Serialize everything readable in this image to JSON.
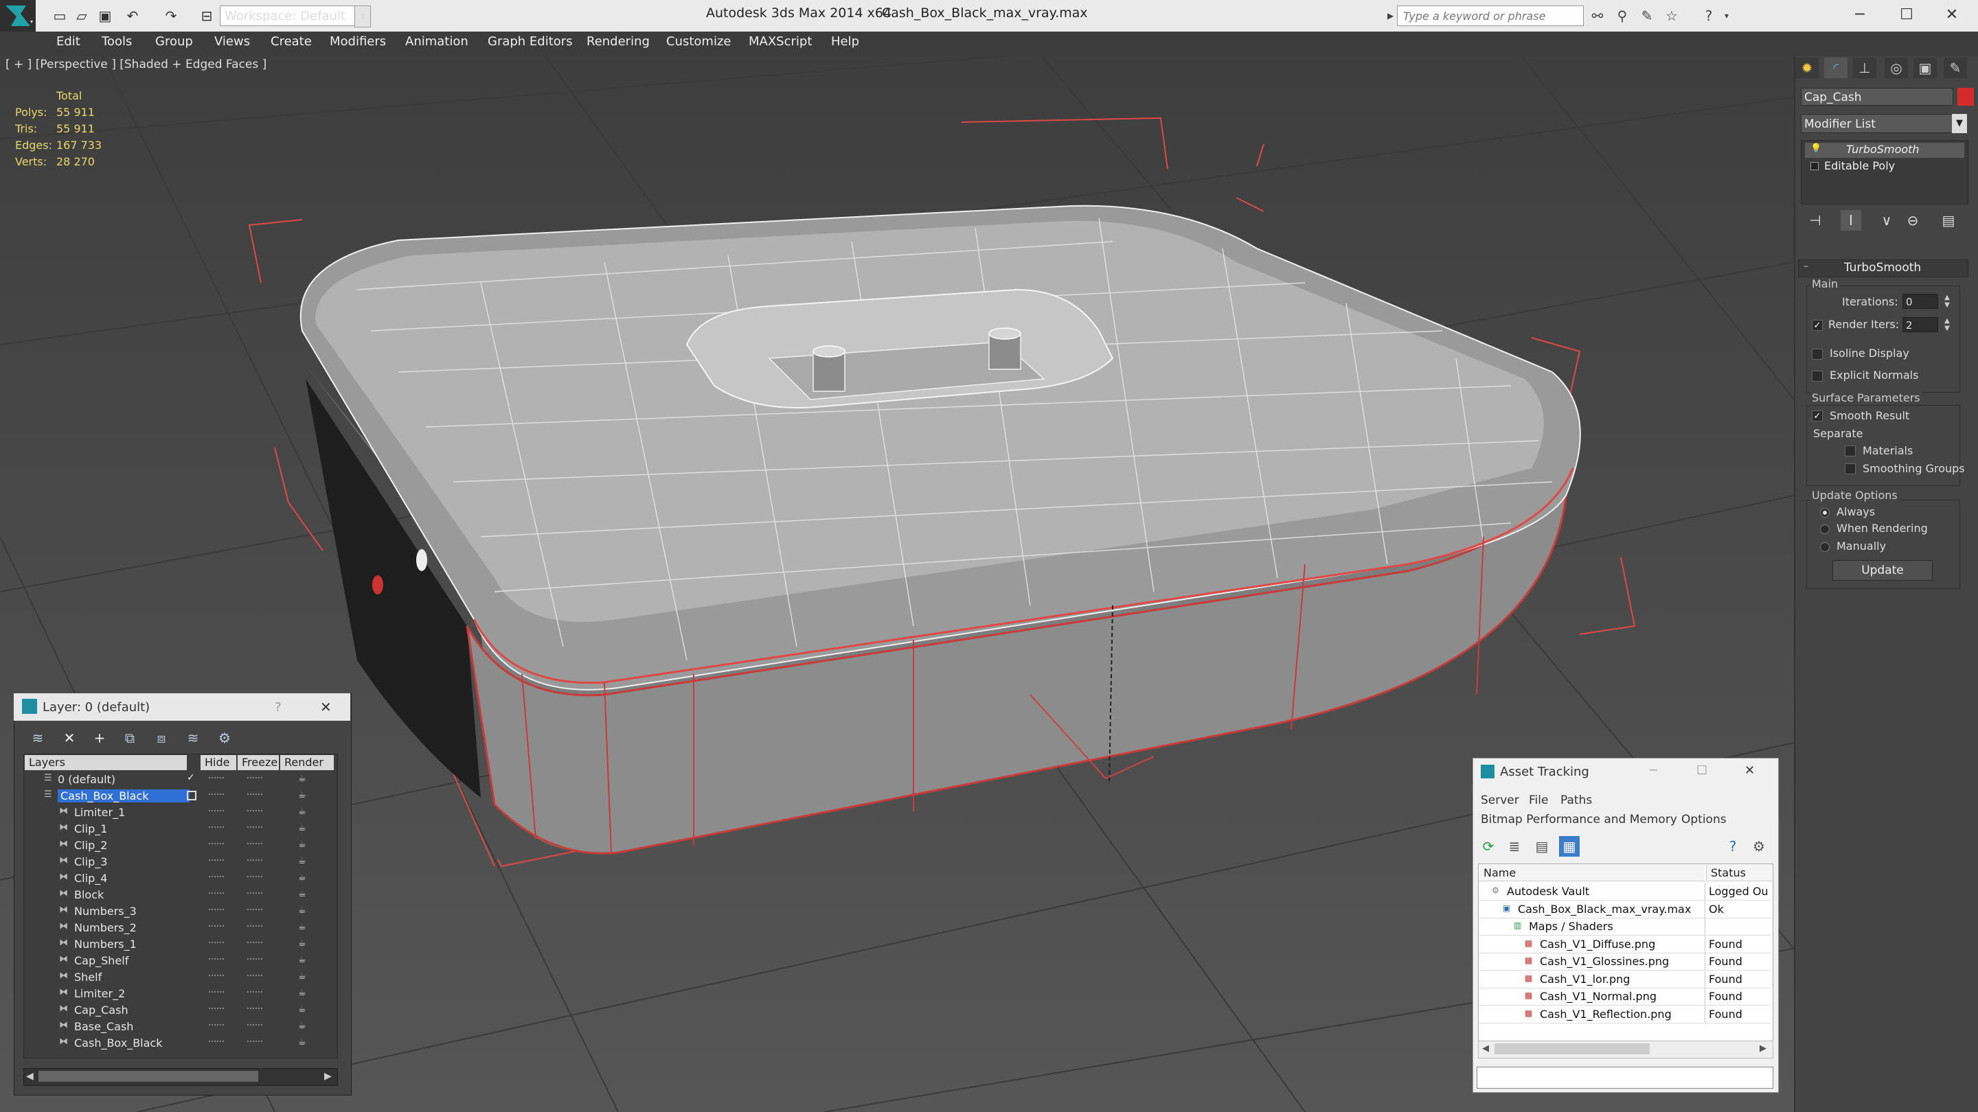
{
  "titlebar": {
    "workspace": "Workspace: Default",
    "app_title": "Autodesk 3ds Max  2014 x64",
    "file_title": "Cash_Box_Black_max_vray.max",
    "search_placeholder": "Type a keyword or phrase"
  },
  "menubar": [
    "Edit",
    "Tools",
    "Group",
    "Views",
    "Create",
    "Modifiers",
    "Animation",
    "Graph Editors",
    "Rendering",
    "Customize",
    "MAXScript",
    "Help"
  ],
  "viewport": {
    "label": "[ + ] [Perspective ] [Shaded + Edged Faces ]",
    "stats": {
      "header": "Total",
      "rows": [
        {
          "label": "Polys:",
          "value": "55 911"
        },
        {
          "label": "Tris:",
          "value": "55 911"
        },
        {
          "label": "Edges:",
          "value": "167 733"
        },
        {
          "label": "Verts:",
          "value": "28 270"
        }
      ]
    }
  },
  "command_panel": {
    "tabs": [
      "create-tab",
      "modify-tab",
      "hierarchy-tab",
      "motion-tab",
      "display-tab",
      "utilities-tab"
    ],
    "object_name": "Cap_Cash",
    "object_color": "#d62b2b",
    "modifier_list": "Modifier List",
    "stack": [
      "TurboSmooth",
      "Editable Poly"
    ],
    "rollout_title": "TurboSmooth",
    "main_group": "Main",
    "iterations_label": "Iterations:",
    "iterations_value": "0",
    "render_iters_label": "Render Iters:",
    "render_iters_value": "2",
    "render_iters_checked": true,
    "isoline_label": "Isoline Display",
    "explicit_normals_label": "Explicit Normals",
    "surface_group": "Surface Parameters",
    "smooth_result_label": "Smooth Result",
    "separate_label": "Separate",
    "materials_label": "Materials",
    "smoothing_groups_label": "Smoothing Groups",
    "update_group": "Update Options",
    "always_label": "Always",
    "when_rendering_label": "When Rendering",
    "manually_label": "Manually",
    "update_button": "Update"
  },
  "layer_dialog": {
    "title": "Layer: 0 (default)",
    "help": "?",
    "headers": {
      "layers": "Layers",
      "hide": "Hide",
      "freeze": "Freeze",
      "render": "Render"
    },
    "rows": [
      {
        "name": "0 (default)",
        "indent": 0,
        "selected": false
      },
      {
        "name": "Cash_Box_Black",
        "indent": 0,
        "selected": true
      },
      {
        "name": "Limiter_1",
        "indent": 1,
        "selected": false
      },
      {
        "name": "Clip_1",
        "indent": 1,
        "selected": false
      },
      {
        "name": "Clip_2",
        "indent": 1,
        "selected": false
      },
      {
        "name": "Clip_3",
        "indent": 1,
        "selected": false
      },
      {
        "name": "Clip_4",
        "indent": 1,
        "selected": false
      },
      {
        "name": "Block",
        "indent": 1,
        "selected": false
      },
      {
        "name": "Numbers_3",
        "indent": 1,
        "selected": false
      },
      {
        "name": "Numbers_2",
        "indent": 1,
        "selected": false
      },
      {
        "name": "Numbers_1",
        "indent": 1,
        "selected": false
      },
      {
        "name": "Cap_Shelf",
        "indent": 1,
        "selected": false
      },
      {
        "name": "Shelf",
        "indent": 1,
        "selected": false
      },
      {
        "name": "Limiter_2",
        "indent": 1,
        "selected": false
      },
      {
        "name": "Cap_Cash",
        "indent": 1,
        "selected": false
      },
      {
        "name": "Base_Cash",
        "indent": 1,
        "selected": false
      },
      {
        "name": "Cash_Box_Black",
        "indent": 1,
        "selected": false
      }
    ]
  },
  "asset_tracking": {
    "title": "Asset Tracking",
    "menu1": [
      "Server",
      "File",
      "Paths"
    ],
    "menu2": [
      "Bitmap Performance and Memory",
      "Options"
    ],
    "headers": {
      "name": "Name",
      "status": "Status"
    },
    "rows": [
      {
        "name": "Autodesk Vault",
        "status": "Logged Ou",
        "indent": 0
      },
      {
        "name": "Cash_Box_Black_max_vray.max",
        "status": "Ok",
        "indent": 1
      },
      {
        "name": "Maps / Shaders",
        "status": "",
        "indent": 2
      },
      {
        "name": "Cash_V1_Diffuse.png",
        "status": "Found",
        "indent": 3
      },
      {
        "name": "Cash_V1_Glossines.png",
        "status": "Found",
        "indent": 3
      },
      {
        "name": "Cash_V1_lor.png",
        "status": "Found",
        "indent": 3
      },
      {
        "name": "Cash_V1_Normal.png",
        "status": "Found",
        "indent": 3
      },
      {
        "name": "Cash_V1_Reflection.png",
        "status": "Found",
        "indent": 3
      }
    ]
  }
}
